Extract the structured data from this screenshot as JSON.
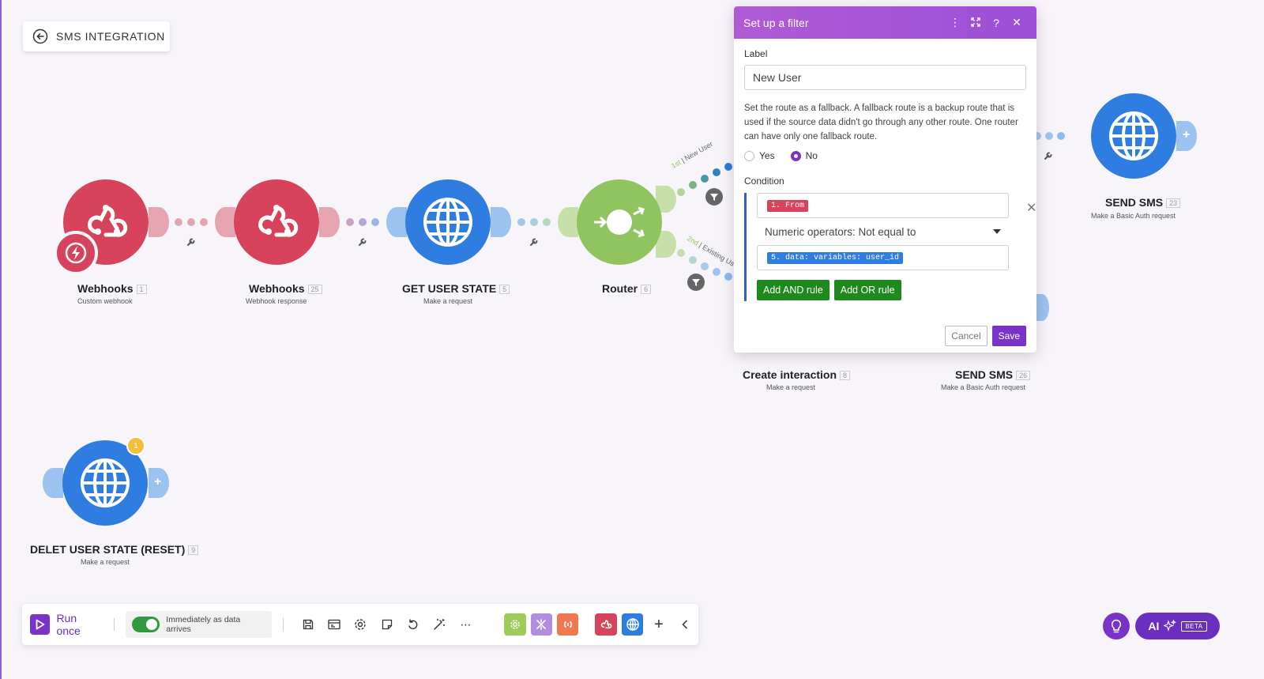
{
  "scenario": {
    "title": "SMS INTEGRATION"
  },
  "modules": {
    "webhooks_1": {
      "name": "Webhooks",
      "index": "1",
      "subtitle": "Custom webhook"
    },
    "webhooks_25": {
      "name": "Webhooks",
      "index": "25",
      "subtitle": "Webhook response"
    },
    "get_user_state": {
      "name": "GET USER STATE",
      "index": "5",
      "subtitle": "Make a request"
    },
    "router": {
      "name": "Router",
      "index": "6"
    },
    "send_sms_23": {
      "name": "SEND SMS",
      "index": "23",
      "subtitle": "Make a Basic Auth request"
    },
    "create_interaction": {
      "name": "Create interaction",
      "index": "8",
      "subtitle": "Make a request"
    },
    "send_sms_26": {
      "name": "SEND SMS",
      "index": "26",
      "subtitle": "Make a Basic Auth request"
    },
    "delete_user_state": {
      "name": "DELET USER STATE (RESET)",
      "index": "9",
      "subtitle": "Make a request",
      "badge": "1"
    }
  },
  "routes": {
    "first": {
      "order": "1st",
      "label": "New User"
    },
    "second": {
      "order": "2nd",
      "label": "Existing Us"
    }
  },
  "filter_panel": {
    "title": "Set up a filter",
    "label_heading": "Label",
    "label_value": "New User",
    "fallback_help": "Set the route as a fallback. A fallback route is a backup route that is used if the source data didn't go through any other route. One router can have only one fallback route.",
    "radio_yes": "Yes",
    "radio_no": "No",
    "condition_heading": "Condition",
    "condition_left": "1. From",
    "operator": "Numeric operators: Not equal to",
    "condition_right": "5. data: variables: user_id",
    "add_and": "Add AND rule",
    "add_or": "Add OR rule",
    "cancel": "Cancel",
    "save": "Save"
  },
  "toolbar": {
    "run_once": "Run once",
    "schedule": "Immediately as data arrives"
  },
  "ai": {
    "label": "AI",
    "beta": "BETA"
  },
  "colors": {
    "webhook": "#d6435b",
    "http": "#2f7de1",
    "router": "#8fc45e",
    "accent": "#7a33c9"
  }
}
